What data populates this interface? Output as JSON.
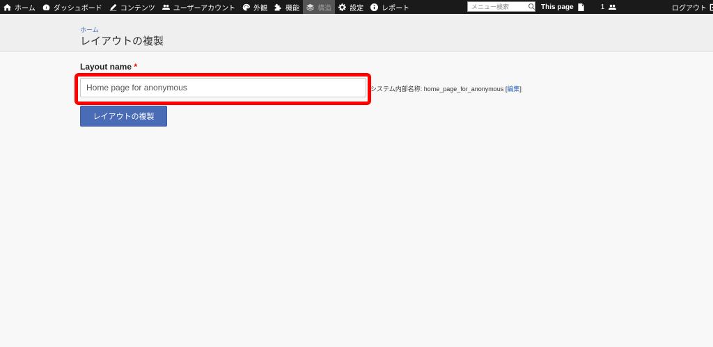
{
  "toolbar": {
    "items": [
      {
        "label": "ホーム",
        "icon": "home-icon"
      },
      {
        "label": "ダッシュボード",
        "icon": "dashboard-icon"
      },
      {
        "label": "コンテンツ",
        "icon": "pencil-icon"
      },
      {
        "label": "ユーザーアカウント",
        "icon": "users-icon"
      },
      {
        "label": "外観",
        "icon": "palette-icon"
      },
      {
        "label": "機能",
        "icon": "puzzle-icon"
      },
      {
        "label": "構造",
        "icon": "layers-icon"
      },
      {
        "label": "設定",
        "icon": "gear-icon"
      },
      {
        "label": "レポート",
        "icon": "info-icon"
      }
    ],
    "search_placeholder": "メニュー検索",
    "this_page_label": "This page",
    "user_count": "1",
    "logout_label": "ログアウト"
  },
  "header": {
    "breadcrumb": "ホーム",
    "title": "レイアウトの複製"
  },
  "form": {
    "field_label": "Layout name",
    "required_mark": "*",
    "input_value": "Home page for anonymous",
    "machine_name_prefix": "システム内部名称: ",
    "machine_name_value": "home_page_for_anonymous",
    "edit_open": " [",
    "edit_link": "編集",
    "edit_close": "]",
    "submit_label": "レイアウトの複製"
  },
  "colors": {
    "toolbar_bg": "#1a1a1a",
    "accent_button": "#4a6bb5",
    "highlight": "#ff0000",
    "link": "#2a62b3"
  }
}
